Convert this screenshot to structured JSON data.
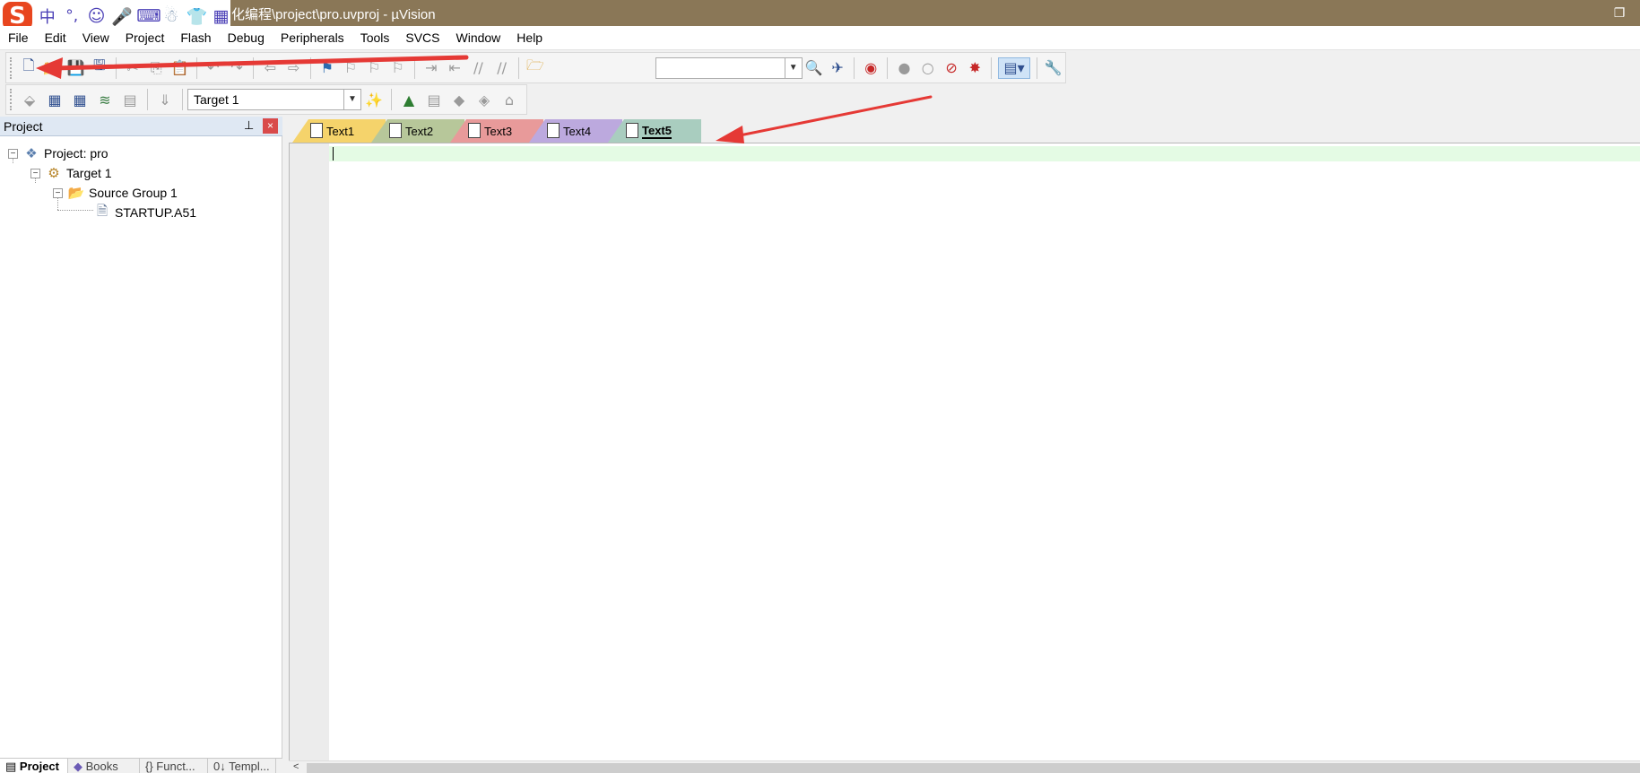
{
  "titlebar": {
    "title": "化编程\\project\\pro.uvproj - µVision",
    "max_icon": "restore-icon"
  },
  "ime_toolbar": {
    "logo": "S",
    "mode": "中",
    "punct": "°,",
    "icons": [
      "emoji-icon",
      "microphone-icon",
      "keyboard-icon",
      "user-icon",
      "shirt-icon",
      "grid-icon"
    ]
  },
  "menu": [
    "File",
    "Edit",
    "View",
    "Project",
    "Flash",
    "Debug",
    "Peripherals",
    "Tools",
    "SVCS",
    "Window",
    "Help"
  ],
  "toolbar2": {
    "target_value": "Target 1"
  },
  "project_panel": {
    "title": "Project",
    "pin": "⊥",
    "close": "×",
    "tree": [
      {
        "label": "Project: pro",
        "level": 0
      },
      {
        "label": "Target 1",
        "level": 1
      },
      {
        "label": "Source Group 1",
        "level": 2
      },
      {
        "label": "STARTUP.A51",
        "level": 3
      }
    ],
    "bottom_tabs": [
      "Project",
      "Books",
      "{} Funct...",
      "0↓ Templ..."
    ]
  },
  "editor": {
    "tabs": [
      {
        "label": "Text1",
        "color": "#f5d36b"
      },
      {
        "label": "Text2",
        "color": "#b7c79a"
      },
      {
        "label": "Text3",
        "color": "#e89a9a"
      },
      {
        "label": "Text4",
        "color": "#bca9de"
      },
      {
        "label": "Text5",
        "color": "#a9cdbf"
      }
    ],
    "active_tab": "Text5",
    "scroll_left": "<"
  },
  "colors": {
    "titlebar": "#8a7757",
    "annotation_arrow": "#e53935",
    "current_line": "#e4fbe4"
  }
}
